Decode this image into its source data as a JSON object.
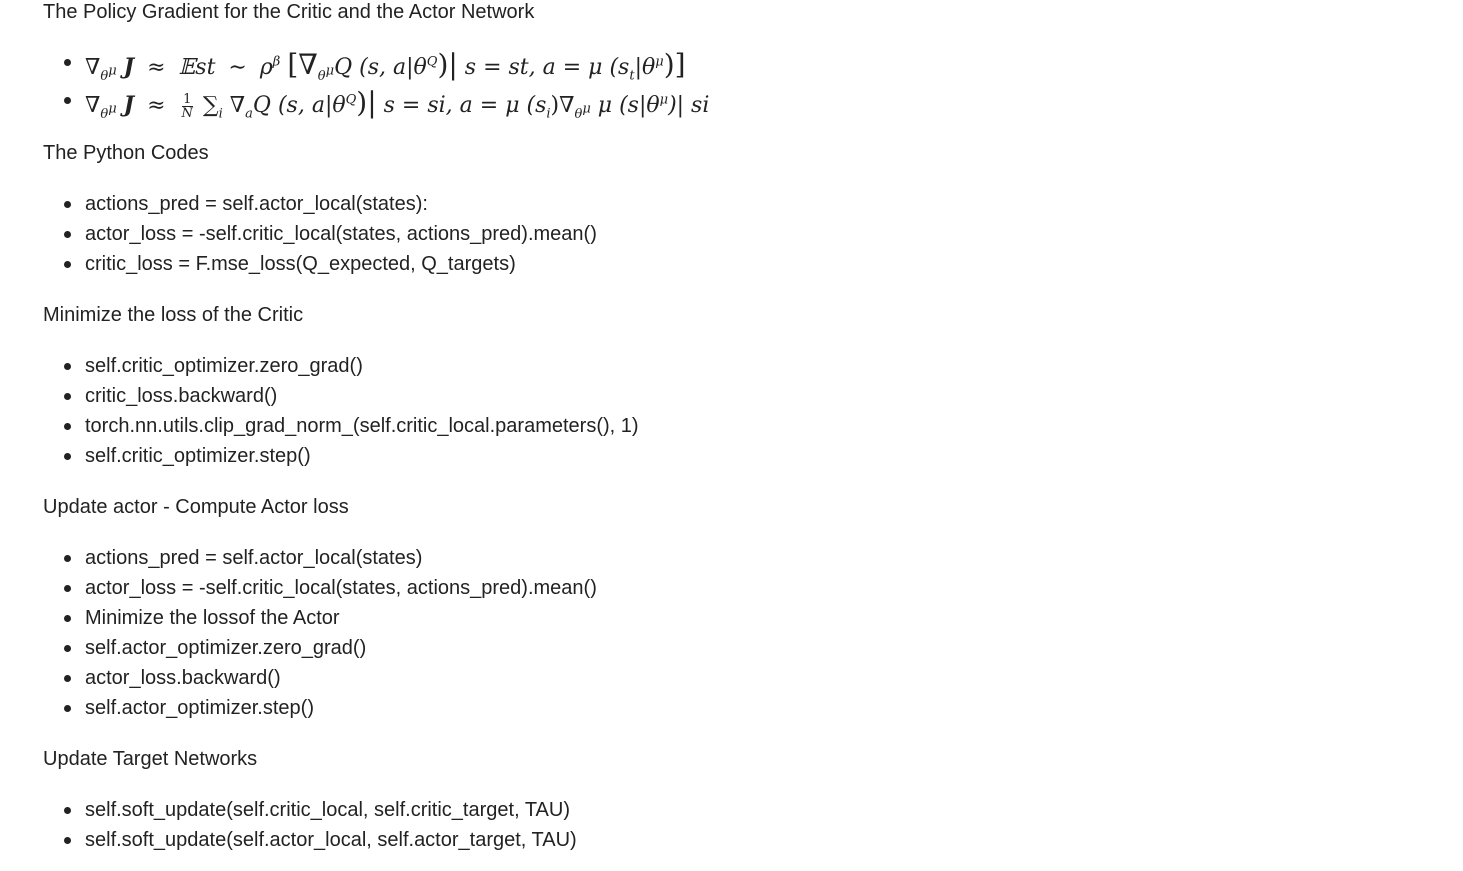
{
  "sections": [
    {
      "heading": "The Policy Gradient for the Critic and the Actor Network",
      "kind": "math",
      "formulas": [
        {
          "parts": [
            "∇",
            "θ",
            "μ",
            "J",
            "≈",
            "𝔼st",
            "∼",
            "ρ",
            "β",
            "[∇",
            "θ",
            "μ",
            "Q",
            "(s, a|θ",
            "Q",
            ")|",
            "s = st, a = μ (s",
            "t",
            "|θ",
            "μ",
            ")]"
          ]
        },
        {
          "parts": [
            "∇",
            "θ",
            "μ",
            "J",
            "≈",
            "1",
            "N",
            "∑",
            "i",
            "∇",
            "a",
            "Q",
            "(s, a|θ",
            "Q",
            ")|",
            "s = si, a = μ (s",
            "i",
            ")∇",
            "θ",
            "μ",
            "μ (s|θ",
            "μ",
            ")| si"
          ]
        }
      ]
    },
    {
      "heading": "The Python Codes",
      "kind": "list",
      "items": [
        "actions_pred = self.actor_local(states):",
        "actor_loss = -self.critic_local(states, actions_pred).mean()",
        "critic_loss = F.mse_loss(Q_expected, Q_targets)"
      ]
    },
    {
      "heading": "Minimize the loss of the Critic",
      "kind": "list",
      "items": [
        "self.critic_optimizer.zero_grad()",
        "critic_loss.backward()",
        "torch.nn.utils.clip_grad_norm_(self.critic_local.parameters(), 1)",
        "self.critic_optimizer.step()"
      ]
    },
    {
      "heading": "Update actor - Compute Actor loss",
      "kind": "list",
      "items": [
        "actions_pred = self.actor_local(states)",
        "actor_loss = -self.critic_local(states, actions_pred).mean()",
        "Minimize the lossof the Actor",
        "self.actor_optimizer.zero_grad()",
        "actor_loss.backward()",
        "self.actor_optimizer.step()"
      ]
    },
    {
      "heading": "Update Target Networks",
      "kind": "list",
      "items": [
        "self.soft_update(self.critic_local, self.critic_target, TAU)",
        "self.soft_update(self.actor_local, self.actor_target, TAU)"
      ]
    }
  ]
}
